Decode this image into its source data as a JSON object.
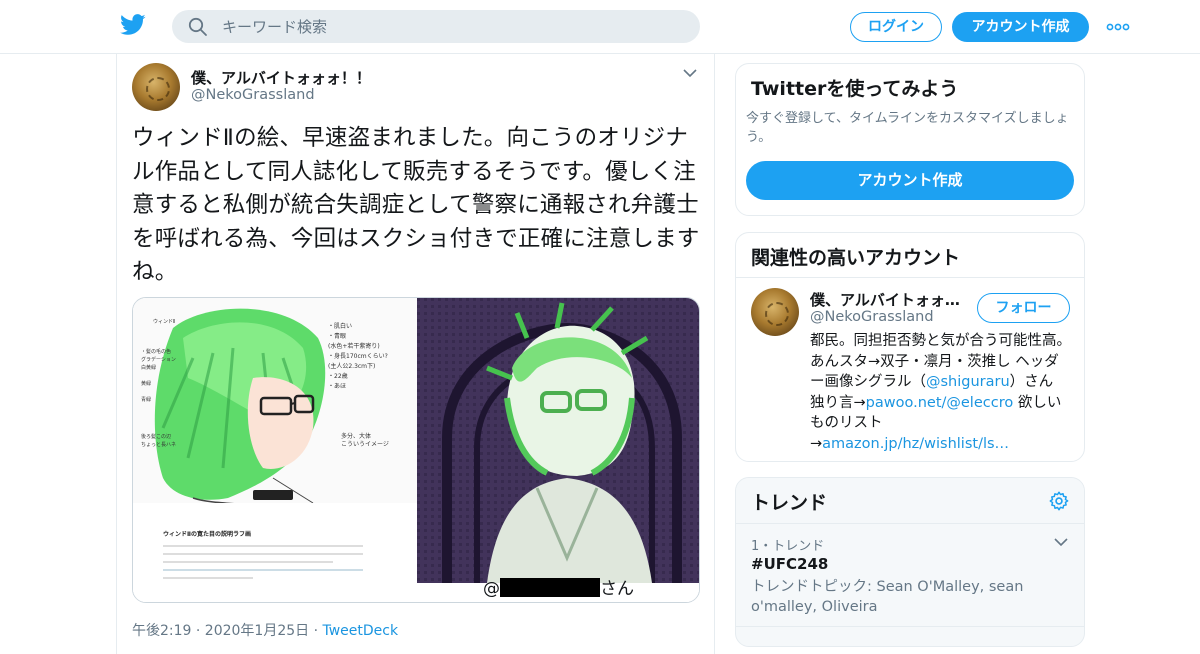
{
  "header": {
    "search_placeholder": "キーワード検索",
    "login_label": "ログイン",
    "signup_label": "アカウント作成"
  },
  "tweet": {
    "author_name": "僕、アルバイトォォォ！！",
    "author_handle": "@NekoGrassland",
    "text": "ウィンドⅡの絵、早速盗まれました。向こうのオリジナル作品として同人誌化して販売するそうです。優しく注意すると私側が統合失調症として警察に通報され弁護士を呼ばれる為、今回はスクショ付きで正確に注意しますね。",
    "media_caption_prefix": "@",
    "media_caption_suffix": "さん",
    "date": "午後2:19 · 2020年1月25日 · ",
    "source": "TweetDeck"
  },
  "signup_card": {
    "title": "Twitterを使ってみよう",
    "subtitle": "今すぐ登録して、タイムラインをカスタマイズしましょう。",
    "button_label": "アカウント作成"
  },
  "related_card": {
    "title": "関連性の高いアカウント",
    "name": "僕、アルバイトォォォ！！",
    "handle": "@NekoGrassland",
    "follow_label": "フォロー",
    "bio_1": "都民。同担拒否勢と気が合う可能性高。あんスタ→双子・凛月・茨推し ヘッダー画像シグラル（",
    "bio_link_1": "@shiguraru",
    "bio_2": "）さん 独り言→",
    "bio_link_2": "pawoo.net/@eleccro",
    "bio_3": " 欲しいものリスト→",
    "bio_link_3": "amazon.jp/hz/wishlist/ls…"
  },
  "trends_card": {
    "title": "トレンド",
    "items": [
      {
        "meta": "1・トレンド",
        "tag": "#UFC248",
        "topic": "トレンドトピック: Sean O'Malley, sean o'malley, Oliveira"
      }
    ]
  },
  "colors": {
    "accent": "#1da1f2",
    "link": "#1b95e0",
    "secondary_text": "#657786"
  },
  "icons": [
    "twitter-bird-icon",
    "search-icon",
    "more-dots-icon",
    "chevron-down-icon",
    "gear-icon"
  ]
}
